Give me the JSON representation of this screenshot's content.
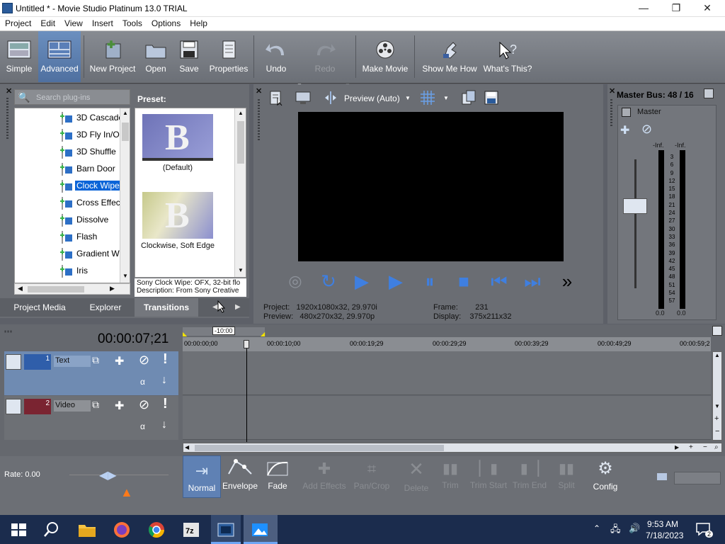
{
  "window": {
    "title": "Untitled * - Movie Studio Platinum 13.0 TRIAL",
    "min": "—",
    "max": "❐",
    "close": "✕"
  },
  "menu": [
    "Project",
    "Edit",
    "View",
    "Insert",
    "Tools",
    "Options",
    "Help"
  ],
  "toolbar": {
    "simple": "Simple",
    "advanced": "Advanced",
    "new_project": "New Project",
    "open": "Open",
    "save": "Save",
    "properties": "Properties",
    "undo": "Undo",
    "redo": "Redo",
    "make_movie": "Make Movie",
    "show_me_how": "Show Me How",
    "whats_this": "What's This?"
  },
  "plugins": {
    "search_placeholder": "Search plug-ins",
    "items": [
      "3D Cascade",
      "3D Fly In/Ou",
      "3D Shuffle",
      "Barn Door",
      "Clock Wipe",
      "Cross Effect",
      "Dissolve",
      "Flash",
      "Gradient Wip",
      "Iris"
    ],
    "selected": "Clock Wipe"
  },
  "preset": {
    "label": "Preset:",
    "items": [
      "(Default)",
      "Clockwise, Soft Edge"
    ],
    "desc1": "Sony Clock Wipe: OFX, 32-bit flo",
    "desc2": "Description: From Sony Creative"
  },
  "tabs": {
    "project_media": "Project Media",
    "explorer": "Explorer",
    "transitions": "Transitions"
  },
  "preview": {
    "mode": "Preview (Auto)",
    "project_label": "Project:",
    "project_value": "1920x1080x32, 29.970i",
    "preview_label": "Preview:",
    "preview_value": "480x270x32, 29.970p",
    "frame_label": "Frame:",
    "frame_value": "231",
    "display_label": "Display:",
    "display_value": "375x211x32"
  },
  "mixer": {
    "title": "Master Bus: 48 / 16",
    "master": "Master",
    "inf_left": "-Inf.",
    "inf_right": "-Inf.",
    "scale": [
      "3",
      "6",
      "9",
      "12",
      "15",
      "18",
      "21",
      "24",
      "27",
      "30",
      "33",
      "36",
      "39",
      "42",
      "45",
      "48",
      "51",
      "54",
      "57"
    ],
    "bottom_left": "0.0",
    "bottom_right": "0.0"
  },
  "timeline": {
    "time": "00:00:07;21",
    "loop": "-10:00",
    "ruler": [
      "00:00:00;00",
      "00:00:10;00",
      "00:00:19;29",
      "00:00:29;29",
      "00:00:39;29",
      "00:00:49;29",
      "00:00:59;2"
    ],
    "tracks": [
      {
        "num": "1",
        "name": "Text"
      },
      {
        "num": "2",
        "name": "Video"
      }
    ]
  },
  "rate": "Rate: 0.00",
  "tools": {
    "normal": "Normal",
    "envelope": "Envelope",
    "fade": "Fade",
    "add_effects": "Add Effects",
    "pan_crop": "Pan/Crop",
    "delete": "Delete",
    "trim": "Trim",
    "trim_start": "Trim Start",
    "trim_end": "Trim End",
    "split": "Split",
    "config": "Config"
  },
  "taskbar": {
    "time": "9:53 AM",
    "date": "7/18/2023",
    "notif": "2"
  }
}
